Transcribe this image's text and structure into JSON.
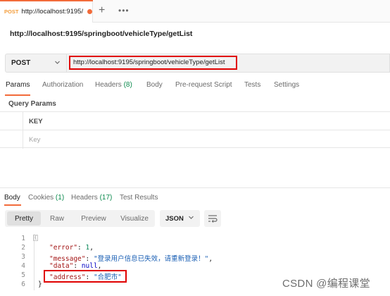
{
  "tab": {
    "method": "POST",
    "title": "http://localhost:9195/"
  },
  "tab_strip": {
    "new_tab": "+",
    "more": "•••"
  },
  "request": {
    "name": "http://localhost:9195/springboot/vehicleType/getList",
    "method": "POST",
    "url": "http://localhost:9195/springboot/vehicleType/getList"
  },
  "request_tabs": [
    {
      "label": "Params"
    },
    {
      "label": "Authorization"
    },
    {
      "label": "Headers",
      "count": "(8)"
    },
    {
      "label": "Body"
    },
    {
      "label": "Pre-request Script"
    },
    {
      "label": "Tests"
    },
    {
      "label": "Settings"
    }
  ],
  "query_params": {
    "title": "Query Params",
    "header_key": "KEY",
    "placeholder_key": "Key"
  },
  "response_tabs": [
    {
      "label": "Body"
    },
    {
      "label": "Cookies",
      "count": "(1)"
    },
    {
      "label": "Headers",
      "count": "(17)"
    },
    {
      "label": "Test Results"
    }
  ],
  "format": {
    "modes": [
      "Pretty",
      "Raw",
      "Preview",
      "Visualize"
    ],
    "active_mode": "Pretty",
    "language": "JSON"
  },
  "code": {
    "line_numbers": [
      "1",
      "2",
      "3",
      "4",
      "5",
      "6"
    ],
    "lines": {
      "l1": "{",
      "l2_key": "\"error\"",
      "l2_sep": ": ",
      "l2_val": "1",
      "l2_end": ",",
      "l3_key": "\"message\"",
      "l3_sep": ": ",
      "l3_val": "\"登录用户信息已失效，请重新登录！\"",
      "l3_end": ",",
      "l4_key": "\"data\"",
      "l4_sep": ": ",
      "l4_val": "null",
      "l4_end": ",",
      "l5_key": "\"address\"",
      "l5_sep": ": ",
      "l5_val": "\"合肥市\"",
      "l6": "}"
    }
  },
  "watermark": "CSDN @编程课堂",
  "colors": {
    "accent": "#f26b3a",
    "highlight_box": "#e00000",
    "count_green": "#0b8a4d"
  }
}
